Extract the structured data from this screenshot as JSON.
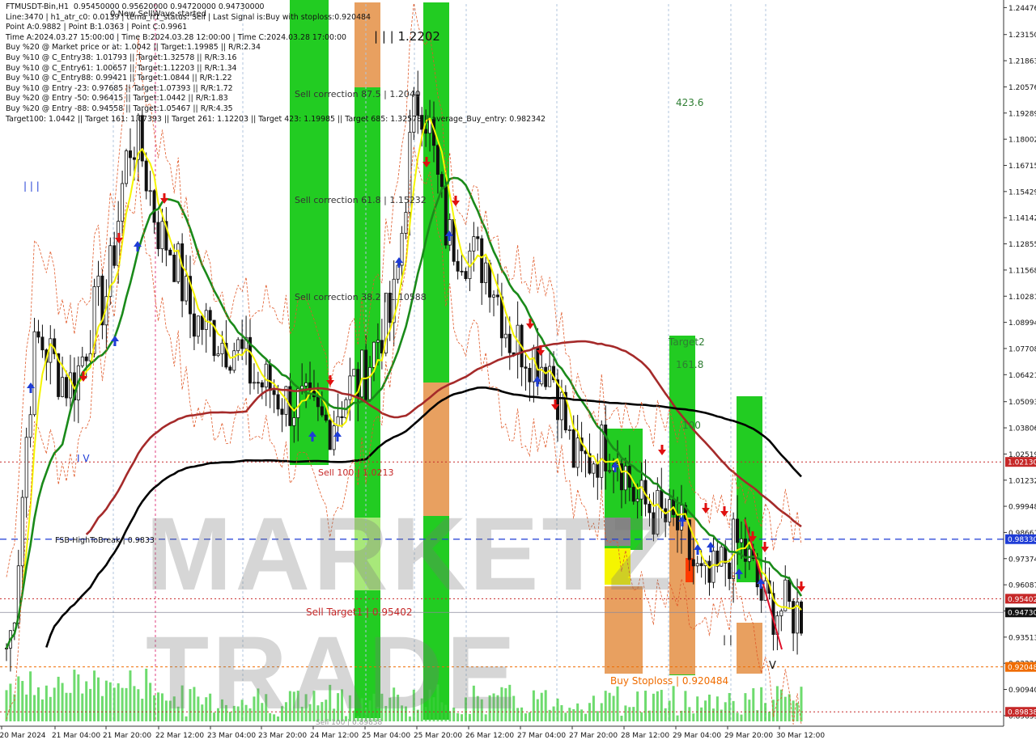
{
  "header": {
    "lines": [
      "FTMUSDT-Bin,H1  0.95450000 0.95620000 0.94720000 0.94730000",
      "Line:3470 | h1_atr_c0: 0.0139 | tema_h1_status: Sell | Last Signal is:Buy with stoploss:0.920484",
      "Point A:0.9882 | Point B:1.0363 | Point C:0.9961",
      "Time A:2024.03.27 15:00:00 | Time B:2024.03.28 12:00:00 | Time C:2024.03.28 17:00:00",
      "Buy %20 @ Market price or at: 1.0042 || Target:1.19985 || R/R:2.34",
      "Buy %10 @ C_Entry38: 1.01793 || Target:1.32578 || R/R:3.16",
      "Buy %10 @ C_Entry61: 1.00657 || Target:1.12203 || R/R:1.34",
      "Buy %10 @ C_Entry88: 0.99421 || Target:1.0844 || R/R:1.22",
      "Buy %10 @ Entry -23: 0.97685 || Target:1.07393 || R/R:1.72",
      "Buy %20 @ Entry -50: 0.96415 || Target:1.0442 || R/R:1.83",
      "Buy %20 @ Entry -88: 0.94558 || Target:1.05467 || R/R:4.35",
      "Target100: 1.0442 || Target 161: 1.07393 || Target 261: 1.12203 || Target 423: 1.19985 || Target 685: 1.32578 || average_Buy_entry: 0.982342"
    ],
    "new_wave": "0 New SellWave started"
  },
  "annotations": {
    "sell_correction_875": "Sell correction 87.5 | 1.2040",
    "sell_correction_618": "Sell correction 61.8 | 1.15232",
    "sell_correction_382": "Sell correction 38.2 | 1.10588",
    "sell_100": "Sell 100 | 1.0213",
    "sell_target1": "Sell Target1 | 0.95402",
    "buy_stoploss": "Buy Stoploss | 0.920484",
    "fsb": "FSB-HighToBreak | 0.9833",
    "peak_label": "| | | 1.2202",
    "level_4236": "423.6",
    "target2": "Target2",
    "level_1618": "161.8",
    "level_100": "100",
    "roman_iii": "| | |",
    "roman_iv": "I V",
    "roman_v": "V",
    "roman_ii": "| |",
    "bottom_text": "Sell 100 | 0.89838"
  },
  "watermark": "MARKETZ TRADE",
  "price_axis": {
    "ticks": [
      "1.24476",
      "1.23150",
      "1.21863",
      "1.20576",
      "1.19289",
      "1.18002",
      "1.16715",
      "1.15429",
      "1.14142",
      "1.12855",
      "1.11568",
      "1.10281",
      "1.08994",
      "1.07708",
      "1.06421",
      "1.05093",
      "1.03806",
      "1.02519",
      "1.01232",
      "0.99948",
      "0.98661",
      "0.97374",
      "0.96087",
      "0.94800",
      "0.93513",
      "0.92226",
      "0.90940",
      "0.89653"
    ],
    "markers": [
      {
        "value": "1.02130",
        "color": "#c62828"
      },
      {
        "value": "0.98330",
        "color": "#1e3cd6"
      },
      {
        "value": "0.95402",
        "color": "#c62828"
      },
      {
        "value": "0.94730",
        "color": "#111111"
      },
      {
        "value": "0.92048",
        "color": "#ef6c00"
      },
      {
        "value": "0.89838",
        "color": "#c62828"
      }
    ]
  },
  "time_axis": {
    "labels": [
      "20 Mar 2024",
      "21 Mar 04:00",
      "21 Mar 20:00",
      "22 Mar 12:00",
      "23 Mar 04:00",
      "23 Mar 20:00",
      "24 Mar 12:00",
      "25 Mar 04:00",
      "25 Mar 20:00",
      "26 Mar 12:00",
      "27 Mar 04:00",
      "27 Mar 20:00",
      "28 Mar 12:00",
      "29 Mar 04:00",
      "29 Mar 20:00",
      "30 Mar 12:00"
    ]
  },
  "colors": {
    "green_zone": "#22cc22",
    "orange_zone": "#e8a060",
    "yellow_line": "#f5f500",
    "green_ma": "#1a8a1a",
    "brown_ma": "#a52a2a",
    "black_ma": "#000000",
    "candle": "#111111"
  },
  "chart_data": {
    "type": "candlestick",
    "symbol": "FTMUSDT-Bin",
    "timeframe": "H1",
    "ylim": [
      0.8937,
      1.2465
    ],
    "x_labels": [
      "20 Mar 2024",
      "21 Mar 04:00",
      "21 Mar 20:00",
      "22 Mar 12:00",
      "23 Mar 04:00",
      "23 Mar 20:00",
      "24 Mar 12:00",
      "25 Mar 04:00",
      "25 Mar 20:00",
      "26 Mar 12:00",
      "27 Mar 04:00",
      "27 Mar 20:00",
      "28 Mar 12:00",
      "29 Mar 04:00",
      "29 Mar 20:00",
      "30 Mar 12:00"
    ],
    "approx_close": [
      0.93,
      1.08,
      1.06,
      1.1,
      1.18,
      1.13,
      1.09,
      1.08,
      1.06,
      1.05,
      1.04,
      1.06,
      1.09,
      1.2,
      1.13,
      1.12,
      1.08,
      1.07,
      1.02,
      1.03,
      1.0,
      0.99,
      0.96,
      0.98,
      0.95,
      0.947
    ],
    "levels": {
      "sell_100": 1.0213,
      "fsb_high_to_break": 0.9833,
      "sell_target1": 0.95402,
      "last_price": 0.9473,
      "buy_stoploss": 0.920484,
      "bottom": 0.89838
    }
  }
}
